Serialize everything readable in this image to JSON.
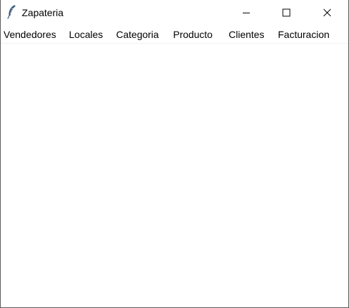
{
  "window": {
    "title": "Zapateria",
    "app_icon": "feather-icon",
    "controls": {
      "minimize": "minimize-icon",
      "maximize": "maximize-icon",
      "close": "close-icon"
    }
  },
  "menubar": {
    "items": [
      {
        "label": "Vendedores"
      },
      {
        "label": "Locales"
      },
      {
        "label": "Categoria"
      },
      {
        "label": "Producto"
      },
      {
        "label": "Clientes"
      },
      {
        "label": "Facturacion"
      }
    ]
  },
  "colors": {
    "background": "#ffffff",
    "text": "#000000",
    "feather": "#3a5a7a"
  }
}
